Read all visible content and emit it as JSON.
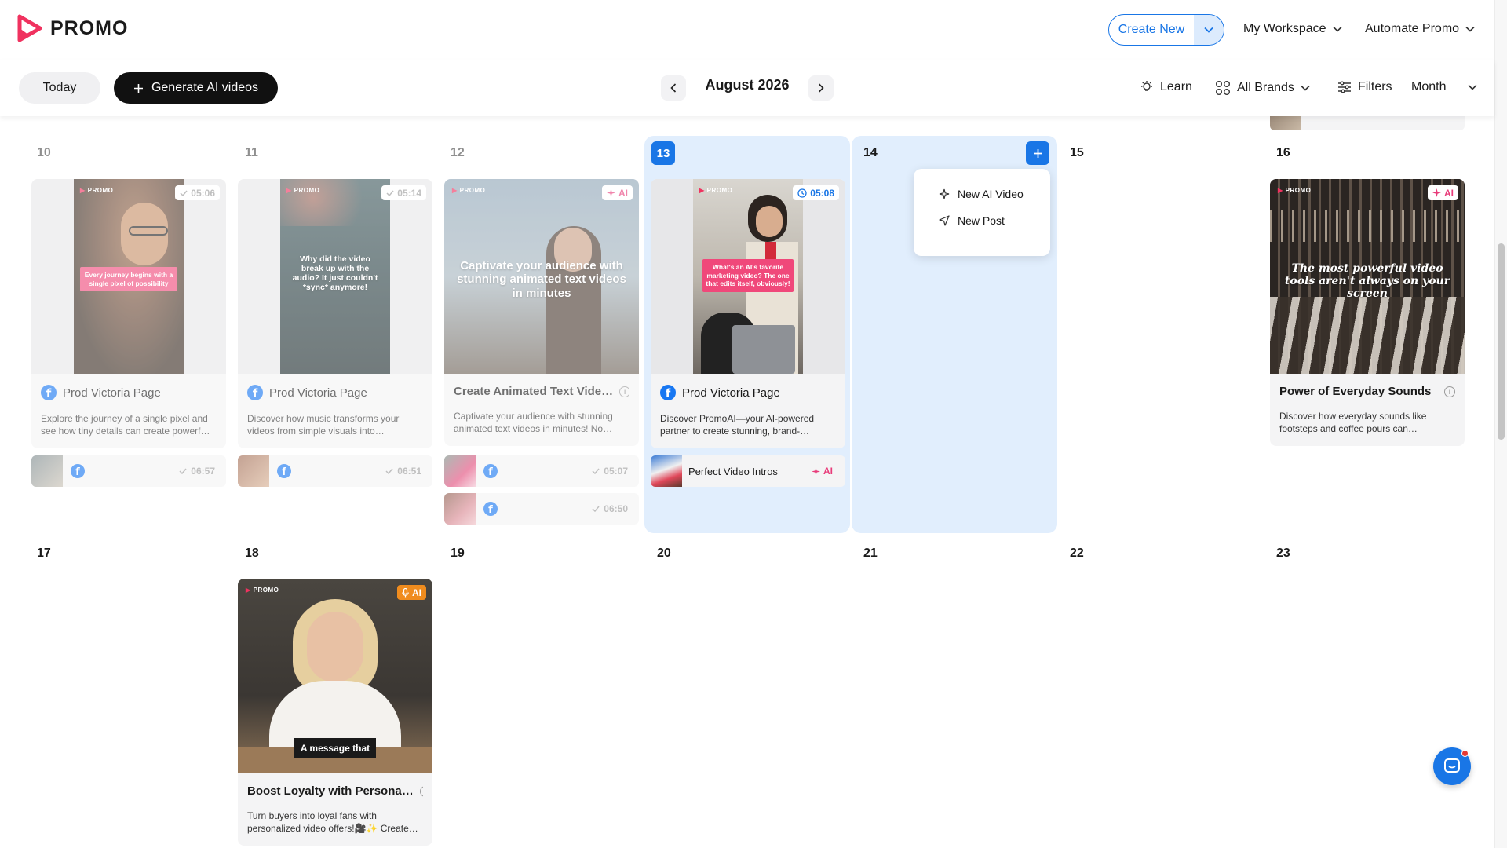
{
  "header": {
    "logo_text": "PROMO",
    "create_new": "Create New",
    "workspace": "My Workspace",
    "automate": "Automate Promo"
  },
  "toolbar": {
    "today": "Today",
    "generate": "Generate AI videos",
    "month_title": "August 2026",
    "learn": "Learn",
    "brands": "All Brands",
    "filters": "Filters",
    "view": "Month"
  },
  "days": {
    "d10": "10",
    "d11": "11",
    "d12": "12",
    "d13": "13",
    "d14": "14",
    "d15": "15",
    "d16": "16",
    "d17": "17",
    "d18": "18",
    "d19": "19",
    "d20": "20",
    "d21": "21",
    "d22": "22",
    "d23": "23"
  },
  "popup": {
    "new_ai_video": "New AI Video",
    "new_post": "New Post"
  },
  "cards": {
    "c10": {
      "badge": "05:06",
      "title": "Prod Victoria Page",
      "desc": "Explore the journey of a single pixel and see how tiny details can create powerf…",
      "overlay": "Every journey begins with a single pixel of possibility",
      "logo": "PROMO"
    },
    "c11": {
      "badge": "05:14",
      "title": "Prod Victoria Page",
      "desc": "Discover how music transforms your videos from simple visuals into…",
      "overlay": "Why did the video break up with the audio? It just couldn't *sync* anymore!",
      "logo": "PROMO"
    },
    "c12": {
      "badge": "AI",
      "title": "Create Animated Text Vide…",
      "desc": "Captivate your audience with stunning animated text videos in minutes! No…",
      "overlay": "Captivate your audience with stunning animated text videos in minutes",
      "logo": "PROMO"
    },
    "c13": {
      "badge": "05:08",
      "title": "Prod Victoria Page",
      "desc": "Discover PromoAI—your AI-powered partner to create stunning, brand-…",
      "overlay": "What's an AI's favorite marketing video? The one that edits itself, obviously!",
      "logo": "PROMO"
    },
    "c16": {
      "badge": "AI",
      "title": "Power of Everyday Sounds",
      "desc": "Discover how everyday sounds like footsteps and coffee pours can…",
      "overlay": "The most powerful video tools aren't always on your screen",
      "logo": "PROMO"
    },
    "c18": {
      "badge": "AI",
      "title": "Boost Loyalty with Persona…",
      "desc": "Turn buyers into loyal fans with personalized video offers!🎥✨ Create…",
      "overlay": "A message that",
      "logo": "PROMO"
    }
  },
  "rows": {
    "r10": {
      "time": "06:57"
    },
    "r11": {
      "time": "06:51"
    },
    "r12a": {
      "time": "05:07"
    },
    "r12b": {
      "time": "06:50"
    },
    "r13": {
      "label": "Perfect Video Intros",
      "ai": "AI"
    }
  },
  "colors": {
    "accent": "#1976e6",
    "highlight": "#e1eefd",
    "ai_pink": "#e83c7a",
    "brand_red": "#f0325f"
  }
}
